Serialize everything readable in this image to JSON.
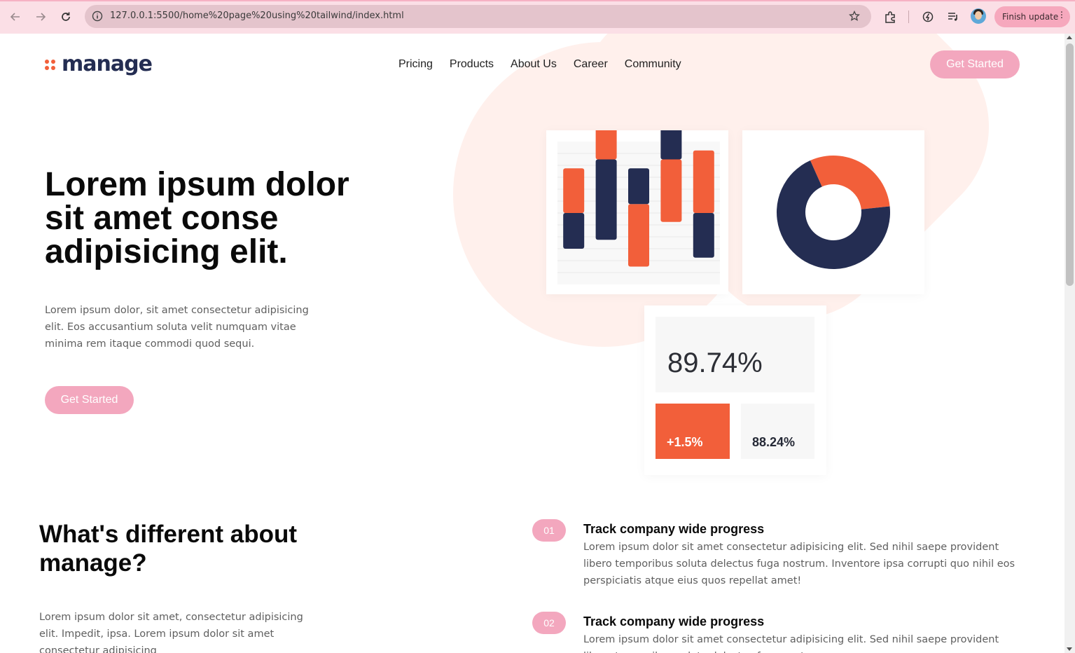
{
  "browser": {
    "url": "127.0.0.1:5500/home%20page%20using%20tailwind/index.html",
    "update_label": "Finish update"
  },
  "header": {
    "logo_text": "manage",
    "nav": [
      "Pricing",
      "Products",
      "About Us",
      "Career",
      "Community"
    ],
    "cta_label": "Get Started"
  },
  "hero": {
    "title": "Lorem ipsum dolor sit amet conse adipisicing elit.",
    "text": "Lorem ipsum dolor, sit amet consectetur adipisicing elit. Eos accusantium soluta velit numquam vitae minima rem itaque commodi quod sequi.",
    "cta_label": "Get Started"
  },
  "stats": {
    "main": "89.74%",
    "change": "+1.5%",
    "secondary": "88.24%"
  },
  "colors": {
    "accent": "#f25f3a",
    "navy": "#242d52",
    "pink": "#f3a7be",
    "blob": "#fff0ec"
  },
  "section": {
    "title": "What's different about manage?",
    "text": "Lorem ipsum dolor sit amet, consectetur adipisicing elit. Impedit, ipsa. Lorem ipsum dolor sit amet consectetur adipisicing"
  },
  "features": [
    {
      "number": "01",
      "title": "Track company wide progress",
      "desc": "Lorem ipsum dolor sit amet consectetur adipisicing elit. Sed nihil saepe provident libero temporibus soluta delectus fuga nostrum. Inventore ipsa corrupti quo nihil eos perspiciatis atque eius quos repellat amet!"
    },
    {
      "number": "02",
      "title": "Track company wide progress",
      "desc": "Lorem ipsum dolor sit amet consectetur adipisicing elit. Sed nihil saepe provident libero temporibus soluta delectus fuga nostrum."
    }
  ],
  "chart_data": [
    {
      "type": "bar",
      "categories": [
        "",
        "",
        "",
        "",
        ""
      ],
      "series": [
        {
          "values": [
            4,
            9,
            4,
            8,
            5
          ],
          "color": "#242d52"
        },
        {
          "values": [
            5,
            5,
            7,
            7,
            7
          ],
          "color": "#f25f3a"
        }
      ]
    },
    {
      "type": "pie",
      "values": [
        30,
        70
      ],
      "colors": [
        "#f25f3a",
        "#242d52"
      ]
    }
  ]
}
